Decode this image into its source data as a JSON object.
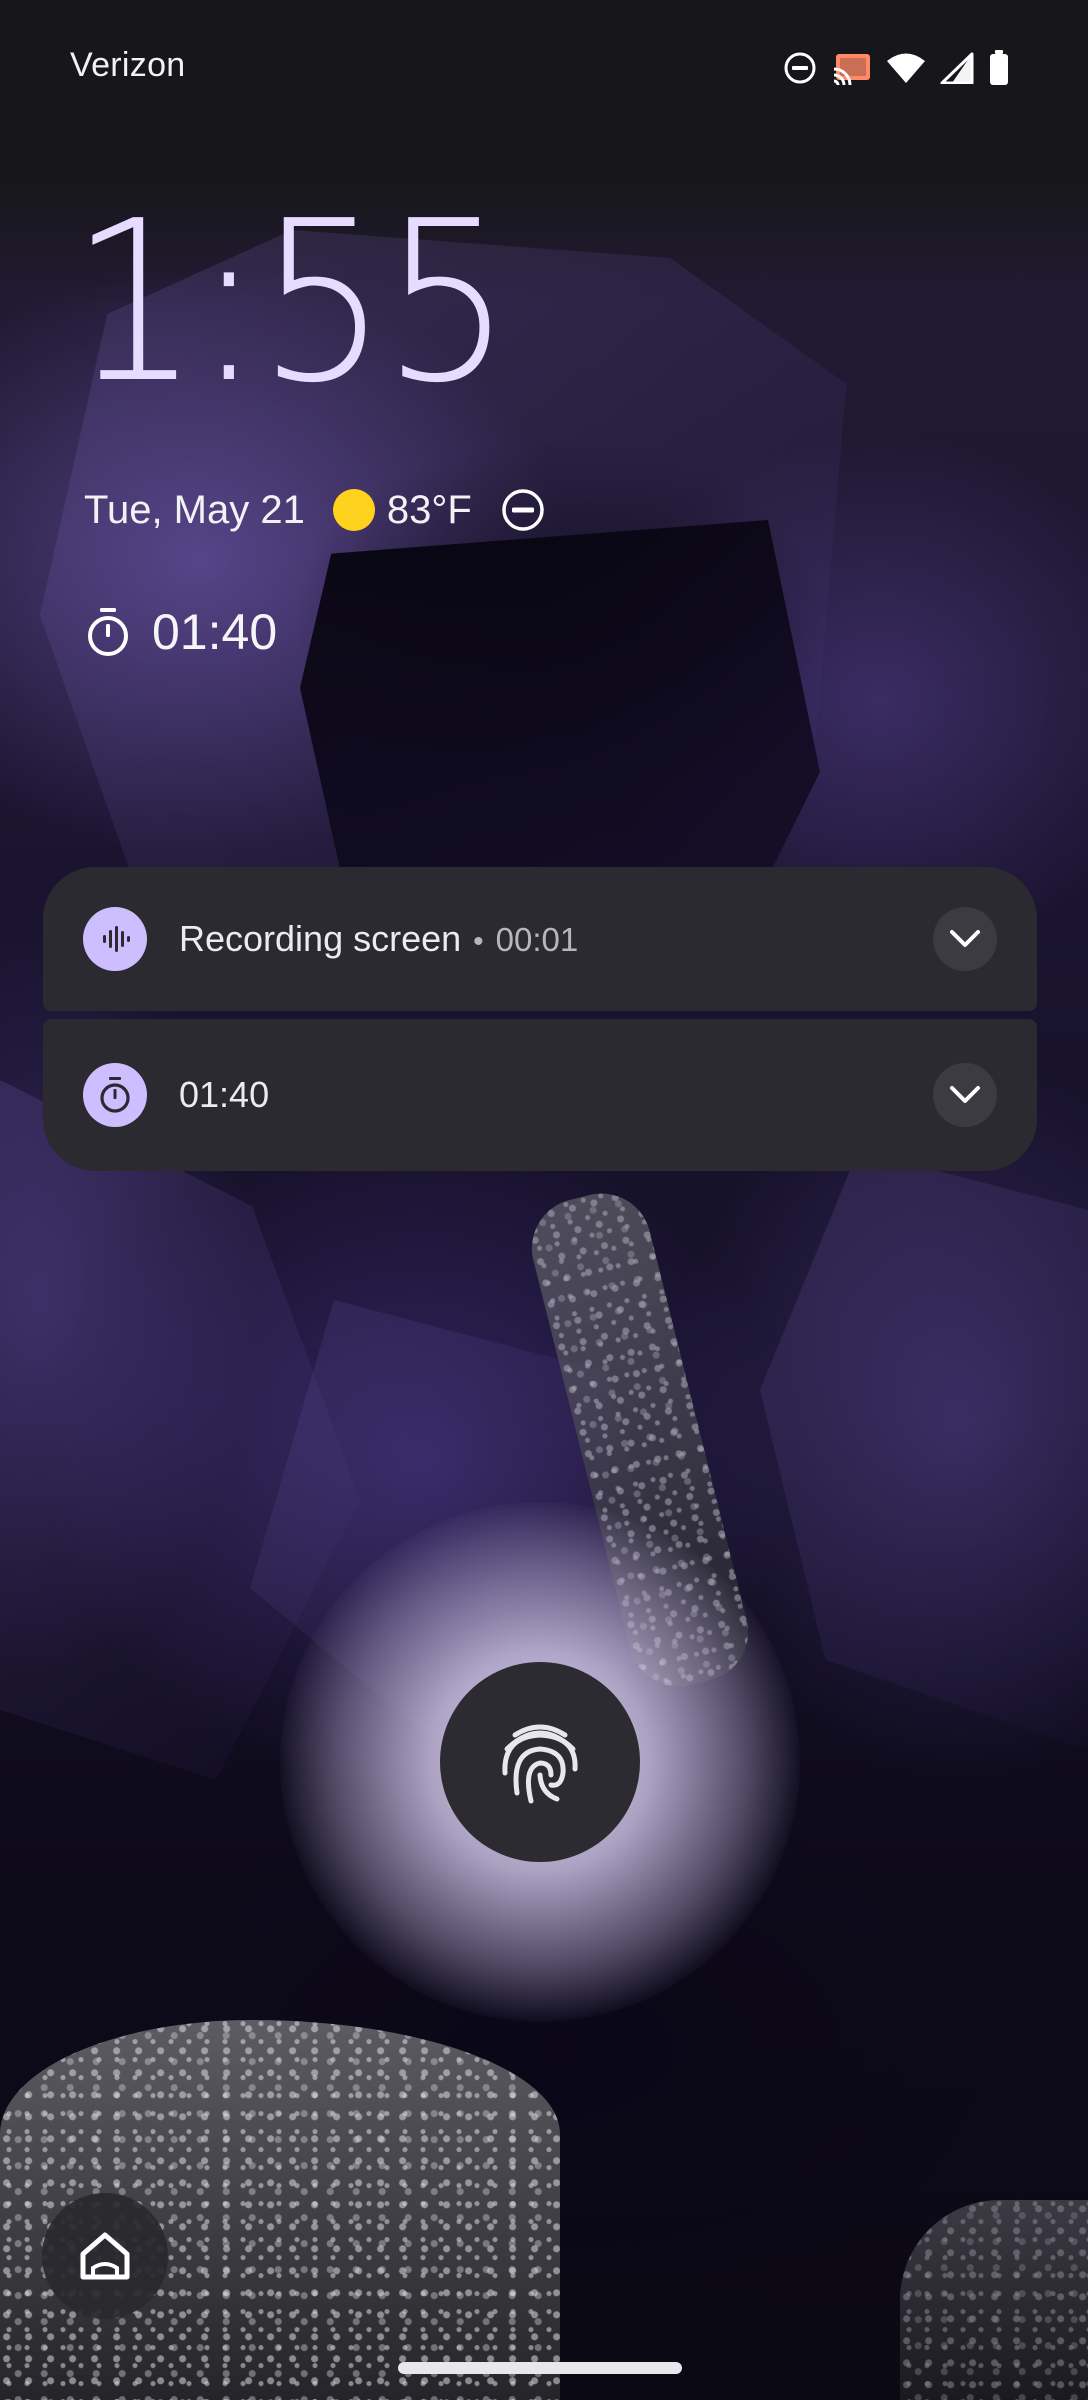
{
  "status_bar": {
    "carrier": "Verizon",
    "icons": [
      "do-not-disturb-icon",
      "cast-icon",
      "wifi-icon",
      "cell-signal-icon",
      "battery-icon"
    ]
  },
  "lockscreen": {
    "time": "1:55",
    "date": "Tue, May 21",
    "weather": {
      "temperature": "83°F",
      "icon": "sun-icon"
    },
    "dnd_indicator": "do-not-disturb-icon",
    "timer": {
      "icon": "timer-icon",
      "value": "01:40"
    }
  },
  "notifications": [
    {
      "app_icon": "screen-record-icon",
      "title": "Recording screen",
      "separator": "•",
      "meta": "00:01",
      "expand_icon": "chevron-down-icon"
    },
    {
      "app_icon": "timer-icon",
      "title": "01:40",
      "expand_icon": "chevron-down-icon"
    }
  ],
  "fingerprint": {
    "icon": "fingerprint-icon"
  },
  "shortcuts": {
    "bottom_left": "home-icon"
  },
  "colors": {
    "clock": "#e6dcff",
    "notification_bg": "#2b2a30",
    "app_icon_bg": "#cdbfff",
    "sun": "#ffd21e"
  }
}
